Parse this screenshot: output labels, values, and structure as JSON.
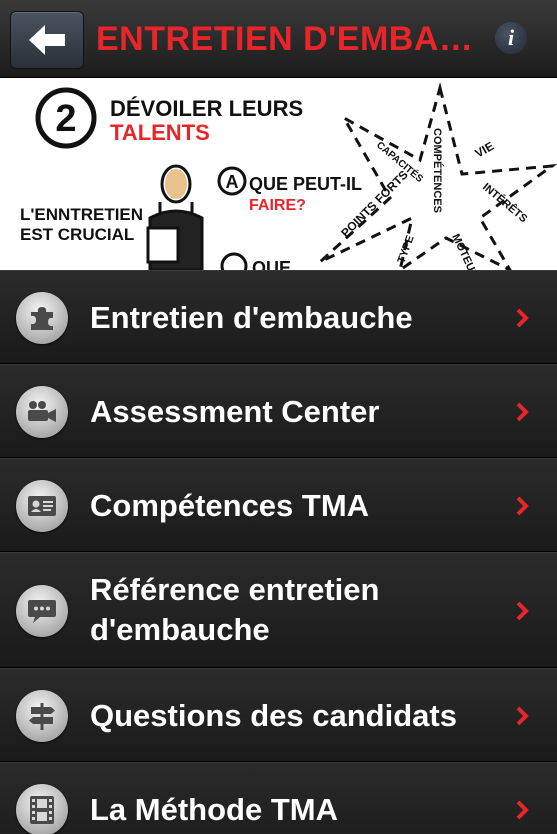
{
  "navbar": {
    "title": "ENTRETIEN D'EMBA…",
    "back_icon": "back-arrow-icon",
    "info_label": "i",
    "title_color": "#e8262a"
  },
  "banner": {
    "step_number": "2",
    "heading_line1": "DÉVOILER LEURS",
    "heading_line2": "TALENTS",
    "sub_letter": "A",
    "question_line1": "QUE PEUT-IL",
    "question_line2": "FAIRE?",
    "left_text_line1": "L'ENNTRETIEN",
    "left_text_line2": "EST CRUCIAL",
    "star_words": [
      "COMPÉTENCES",
      "CAPACITÉS",
      "VIE",
      "INTÉRÊTS",
      "POINTS FORTS",
      "TYPE",
      "MOTEUR"
    ],
    "cut_text": "QUE"
  },
  "menu": {
    "items": [
      {
        "label": "Entretien d'embauche",
        "icon": "puzzle-icon"
      },
      {
        "label": "Assessment Center",
        "icon": "video-camera-icon"
      },
      {
        "label": "Compétences TMA",
        "icon": "id-card-icon"
      },
      {
        "label_line1": "Référence entretien",
        "label_line2": "d'embauche",
        "icon": "speech-bubble-icon"
      },
      {
        "label": "Questions des candidats",
        "icon": "signpost-icon"
      },
      {
        "label": "La Méthode TMA",
        "icon": "film-strip-icon"
      }
    ],
    "chevron_color": "#e8262a"
  }
}
